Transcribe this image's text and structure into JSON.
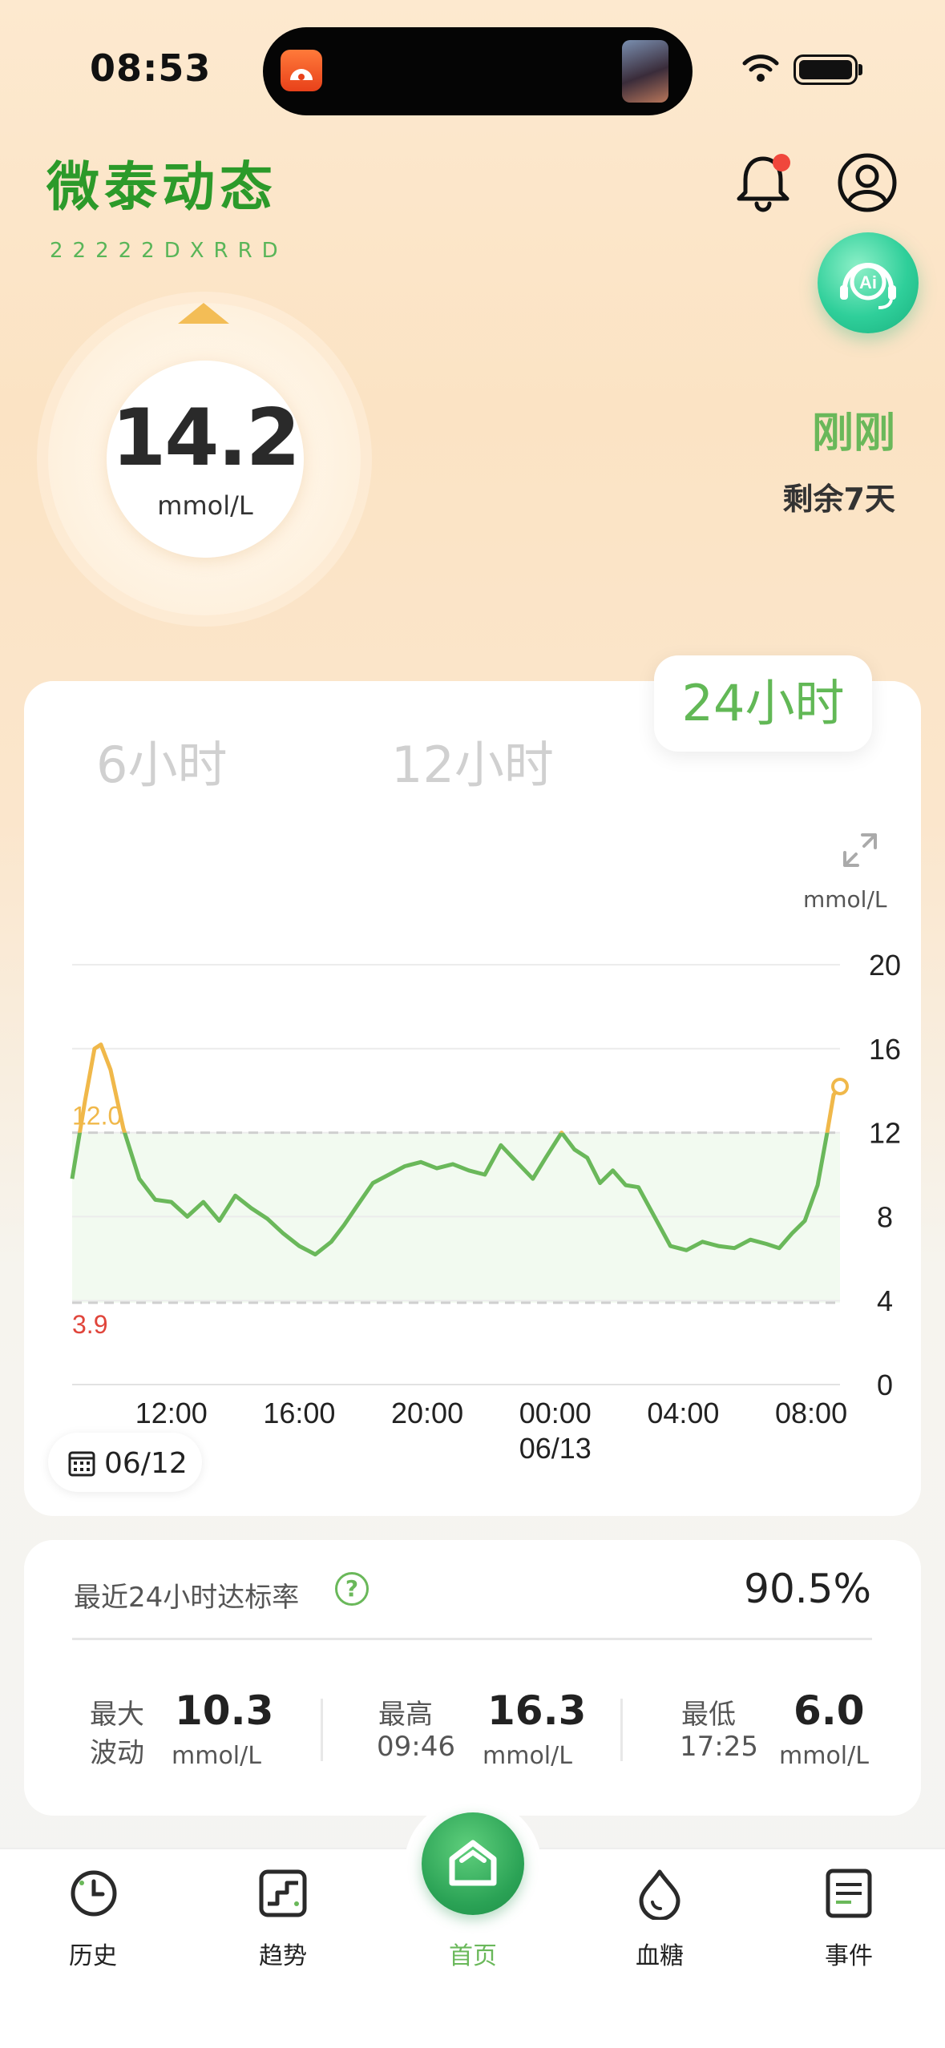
{
  "status_bar": {
    "time": "08:53"
  },
  "header": {
    "title": "微泰动态",
    "device_id": "22222DXRRD"
  },
  "reading": {
    "value": "14.2",
    "unit": "mmol/L",
    "updated": "刚刚",
    "remaining": "剩余7天"
  },
  "tabs": [
    {
      "label": "6小时",
      "active": false
    },
    {
      "label": "12小时",
      "active": false
    },
    {
      "label": "24小时",
      "active": true
    }
  ],
  "chart_data": {
    "type": "line",
    "unit_label": "mmol/L",
    "y_ticks": [
      "20",
      "16",
      "12",
      "8",
      "4",
      "0"
    ],
    "x_tick_labels": [
      "12:00",
      "16:00",
      "20:00",
      "00:00",
      "04:00",
      "08:00"
    ],
    "x_sub_label": "06/13",
    "ylim": [
      0,
      20
    ],
    "xlim_hours": [
      8.9,
      32.9
    ],
    "target_range": {
      "low": 3.9,
      "high": 12.0,
      "low_label": "3.9",
      "high_label": "12.0"
    },
    "colors": {
      "in_range": "#6ab85a",
      "high": "#f0b84a",
      "low_label": "#e0453b",
      "band": "#f2faf0"
    },
    "series": [
      {
        "x": [
          8.9,
          9.3,
          9.6,
          9.8,
          10.1,
          10.5,
          11.0,
          11.5,
          12.0,
          12.5,
          13.0,
          13.5,
          14.0,
          14.5,
          15.0,
          15.5,
          16.0,
          16.5,
          17.0,
          17.4,
          17.8,
          18.3,
          18.8,
          19.3,
          19.8,
          20.3,
          20.8,
          21.3,
          21.8,
          22.3,
          22.8,
          23.3,
          23.7,
          24.2,
          24.6,
          25.0,
          25.4,
          25.8,
          26.2,
          26.6,
          27.1,
          27.6,
          28.1,
          28.6,
          29.1,
          29.6,
          30.1,
          30.6,
          31.0,
          31.4,
          31.8,
          32.2,
          32.5,
          32.7,
          32.9
        ],
        "y": [
          9.8,
          13.5,
          16.0,
          16.2,
          15.0,
          12.2,
          9.8,
          8.8,
          8.7,
          8.0,
          8.7,
          7.8,
          9.0,
          8.4,
          7.9,
          7.2,
          6.6,
          6.2,
          6.8,
          7.6,
          8.5,
          9.6,
          10.0,
          10.4,
          10.6,
          10.3,
          10.5,
          10.2,
          10.0,
          11.4,
          10.6,
          9.8,
          10.8,
          12.0,
          11.2,
          10.8,
          9.6,
          10.2,
          9.5,
          9.4,
          8.0,
          6.6,
          6.4,
          6.8,
          6.6,
          6.5,
          6.9,
          6.7,
          6.5,
          7.2,
          7.8,
          9.5,
          12.0,
          13.8,
          14.2
        ]
      }
    ]
  },
  "date_chip": "06/12",
  "stats": {
    "rate_label": "最近24小时达标率",
    "rate_value": "90.5%",
    "max_fluct_label_1": "最大",
    "max_fluct_label_2": "波动",
    "max_fluct_value": "10.3",
    "max_label": "最高",
    "max_time": "09:46",
    "max_value": "16.3",
    "min_label": "最低",
    "min_time": "17:25",
    "min_value": "6.0",
    "unit": "mmol/L"
  },
  "nav": [
    {
      "label": "历史",
      "icon": "history-icon"
    },
    {
      "label": "趋势",
      "icon": "trend-icon"
    },
    {
      "label": "首页",
      "icon": "home-icon",
      "active": true
    },
    {
      "label": "血糖",
      "icon": "blood-drop-icon"
    },
    {
      "label": "事件",
      "icon": "event-list-icon"
    }
  ]
}
